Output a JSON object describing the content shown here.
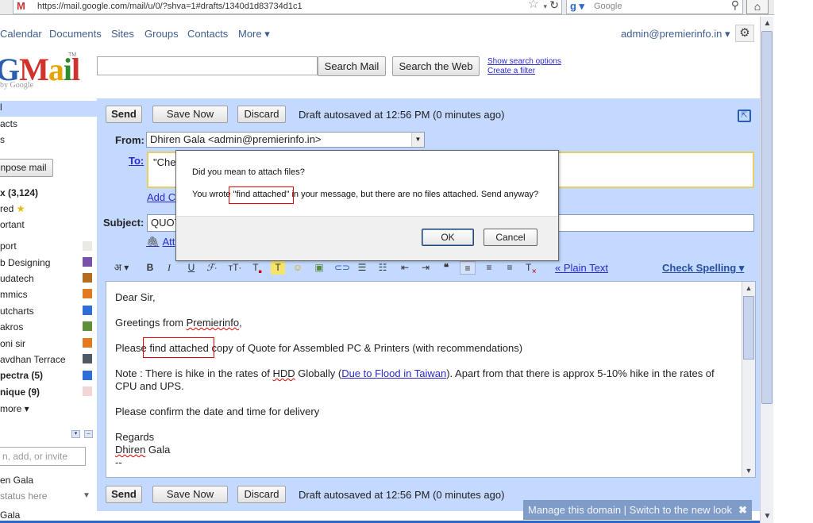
{
  "browser": {
    "url": "https://mail.google.com/mail/u/0/?shva=1#drafts/1340d1d83734d1c1",
    "search_placeholder": "Google"
  },
  "top_nav": {
    "links": [
      "Calendar",
      "Documents",
      "Sites",
      "Groups",
      "Contacts",
      "More ▾"
    ],
    "user": "admin@premierinfo.in ▾"
  },
  "header": {
    "logo_text": "Gmail",
    "logo_sub": "by Google",
    "search_mail_label": "Search Mail",
    "search_web_label": "Search the Web",
    "show_search_options": "Show search options",
    "create_filter": "Create a filter"
  },
  "left_nav": {
    "compose_label": "npose mail",
    "items": [
      {
        "label": "l",
        "bold": false
      },
      {
        "label": "acts",
        "bold": false
      },
      {
        "label": "s",
        "bold": false
      },
      {
        "label": "x (3,124)",
        "bold": true
      },
      {
        "label": "red",
        "bold": false
      },
      {
        "label": "ortant",
        "bold": false
      },
      {
        "label": "port",
        "bold": false
      },
      {
        "label": "b Designing",
        "bold": false
      },
      {
        "label": "udatech",
        "bold": false
      },
      {
        "label": "mmics",
        "bold": false
      },
      {
        "label": "utcharts",
        "bold": false
      },
      {
        "label": "akros",
        "bold": false
      },
      {
        "label": "oni sir",
        "bold": false
      },
      {
        "label": "avdhan Terrace",
        "bold": false
      },
      {
        "label": "pectra (5)",
        "bold": true
      },
      {
        "label": "nique (9)",
        "bold": true
      },
      {
        "label": "more ▾",
        "bold": false
      }
    ],
    "label_colors": [
      "#e9eae3",
      "#7851a9",
      "#b36d1f",
      "#e07b21",
      "#2f6ed6",
      "#5f8f3a",
      "#e07b21",
      "#4f5a66",
      "#2f6ed6",
      "#f2d5d5"
    ],
    "chat_placeholder": "n, add, or invite",
    "chat_contacts": [
      "en Gala",
      "status here",
      "Gala"
    ]
  },
  "compose": {
    "send_label": "Send",
    "save_label": "Save Now",
    "discard_label": "Discard",
    "autosave_text": "Draft autosaved at 12:56 PM (0 minutes ago)",
    "from_label": "From:",
    "from_value": "Dhiren Gala <admin@premierinfo.in>",
    "to_label": "To:",
    "to_value": "\"Chet",
    "add_cc": "Add C",
    "subject_label": "Subject:",
    "subject_value": "QUOT",
    "attach_label": "Att",
    "plain_text": "« Plain Text",
    "check_spelling": "Check Spelling ▾"
  },
  "message": {
    "greeting": "Dear Sir,",
    "line1": "Greetings from Premierinfo,",
    "line2_pre": "Please ",
    "line2_hl": "find attached",
    "line2_post": " copy of Quote for Assembled PC & Printers (with recommendations)",
    "note_pre": "Note : There is hike in the rates of HDD Globally (",
    "note_link": "Due to Flood in Taiwan",
    "note_post": "). Apart from that there is approx 5-10% hike in the rates of CPU and UPS.",
    "confirm": "Please confirm the date and time for delivery",
    "regards": "Regards",
    "name": "Dhiren Gala",
    "sig": "--"
  },
  "dialog": {
    "question": "Did you mean to attach files?",
    "msg_pre": "You wrote ",
    "msg_hl": "\"find attached\"",
    "msg_post": " in your message, but there are no files attached.  Send anyway?",
    "ok_label": "OK",
    "cancel_label": "Cancel"
  },
  "manage_bar": {
    "text": "Manage this domain | Switch to the new look",
    "close": "✖"
  }
}
